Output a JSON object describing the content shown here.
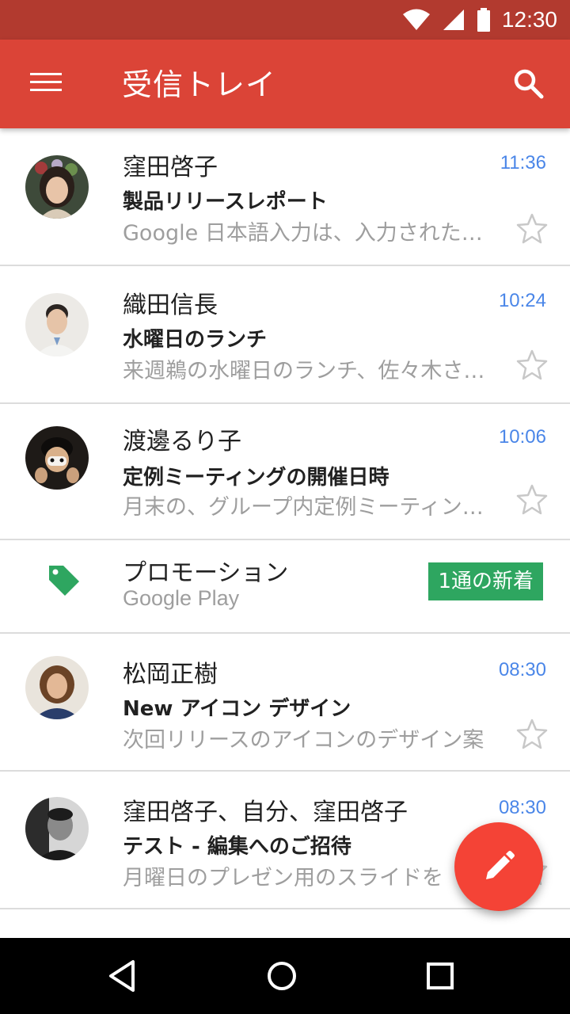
{
  "status_bar": {
    "time": "12:30"
  },
  "app_bar": {
    "title": "受信トレイ"
  },
  "emails": [
    {
      "sender": "窪田啓子",
      "time": "11:36",
      "subject": "製品リリースレポート",
      "snippet": "Google 日本語入力は、入力されたテキスト"
    },
    {
      "sender": "織田信長",
      "time": "10:24",
      "subject": "水曜日のランチ",
      "snippet": "来週鵜の水曜日のランチ、佐々木さんも"
    },
    {
      "sender": "渡邊るり子",
      "time": "10:06",
      "subject": "定例ミーティングの開催日時",
      "snippet": "月末の、グループ内定例ミーティングの"
    }
  ],
  "promotion": {
    "title": "プロモーション",
    "source": "Google Play",
    "badge": "1通の新着"
  },
  "emails2": [
    {
      "sender": "松岡正樹",
      "time": "08:30",
      "subject": "New アイコン デザイン",
      "snippet": "次回リリースのアイコンのデザイン案"
    },
    {
      "sender": "窪田啓子、自分、窪田啓子",
      "time": "08:30",
      "subject": "テスト - 編集へのご招待",
      "snippet": "月曜日のプレゼン用のスライドを"
    }
  ],
  "icons": [
    "menu-icon",
    "search-icon",
    "star-icon",
    "tag-icon",
    "pencil-icon",
    "back-icon",
    "home-icon",
    "recents-icon"
  ],
  "colors": {
    "app_bar": "#db4437",
    "status_bar": "#b23a2f",
    "time": "#4a86e8",
    "badge": "#2ea660",
    "fab": "#f44336"
  }
}
